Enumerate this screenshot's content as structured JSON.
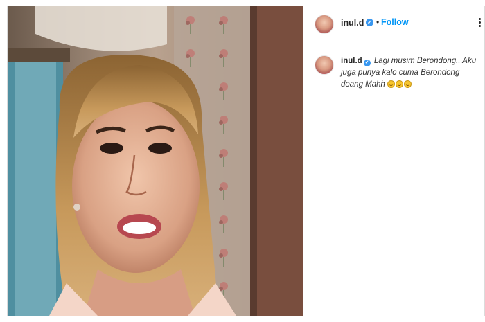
{
  "post": {
    "author": {
      "username": "inul.d",
      "verified": true,
      "avatar_icon": "profile-avatar"
    },
    "follow_label": "Follow",
    "separator": "•",
    "caption": {
      "username": "inul.d",
      "text": "Lagi musim Berondong.. Aku juga punya kalo cuma Berondong doang Mahh",
      "emojis": [
        "rolling-on-floor-laughing-emoji",
        "rolling-on-floor-laughing-emoji",
        "rolling-on-floor-laughing-emoji"
      ]
    },
    "media": {
      "type": "video",
      "content_icon": "woman-talking-video"
    }
  },
  "colors": {
    "accent": "#0095f6",
    "verified": "#3897f0",
    "text": "#262626",
    "border": "#dbdbdb"
  }
}
